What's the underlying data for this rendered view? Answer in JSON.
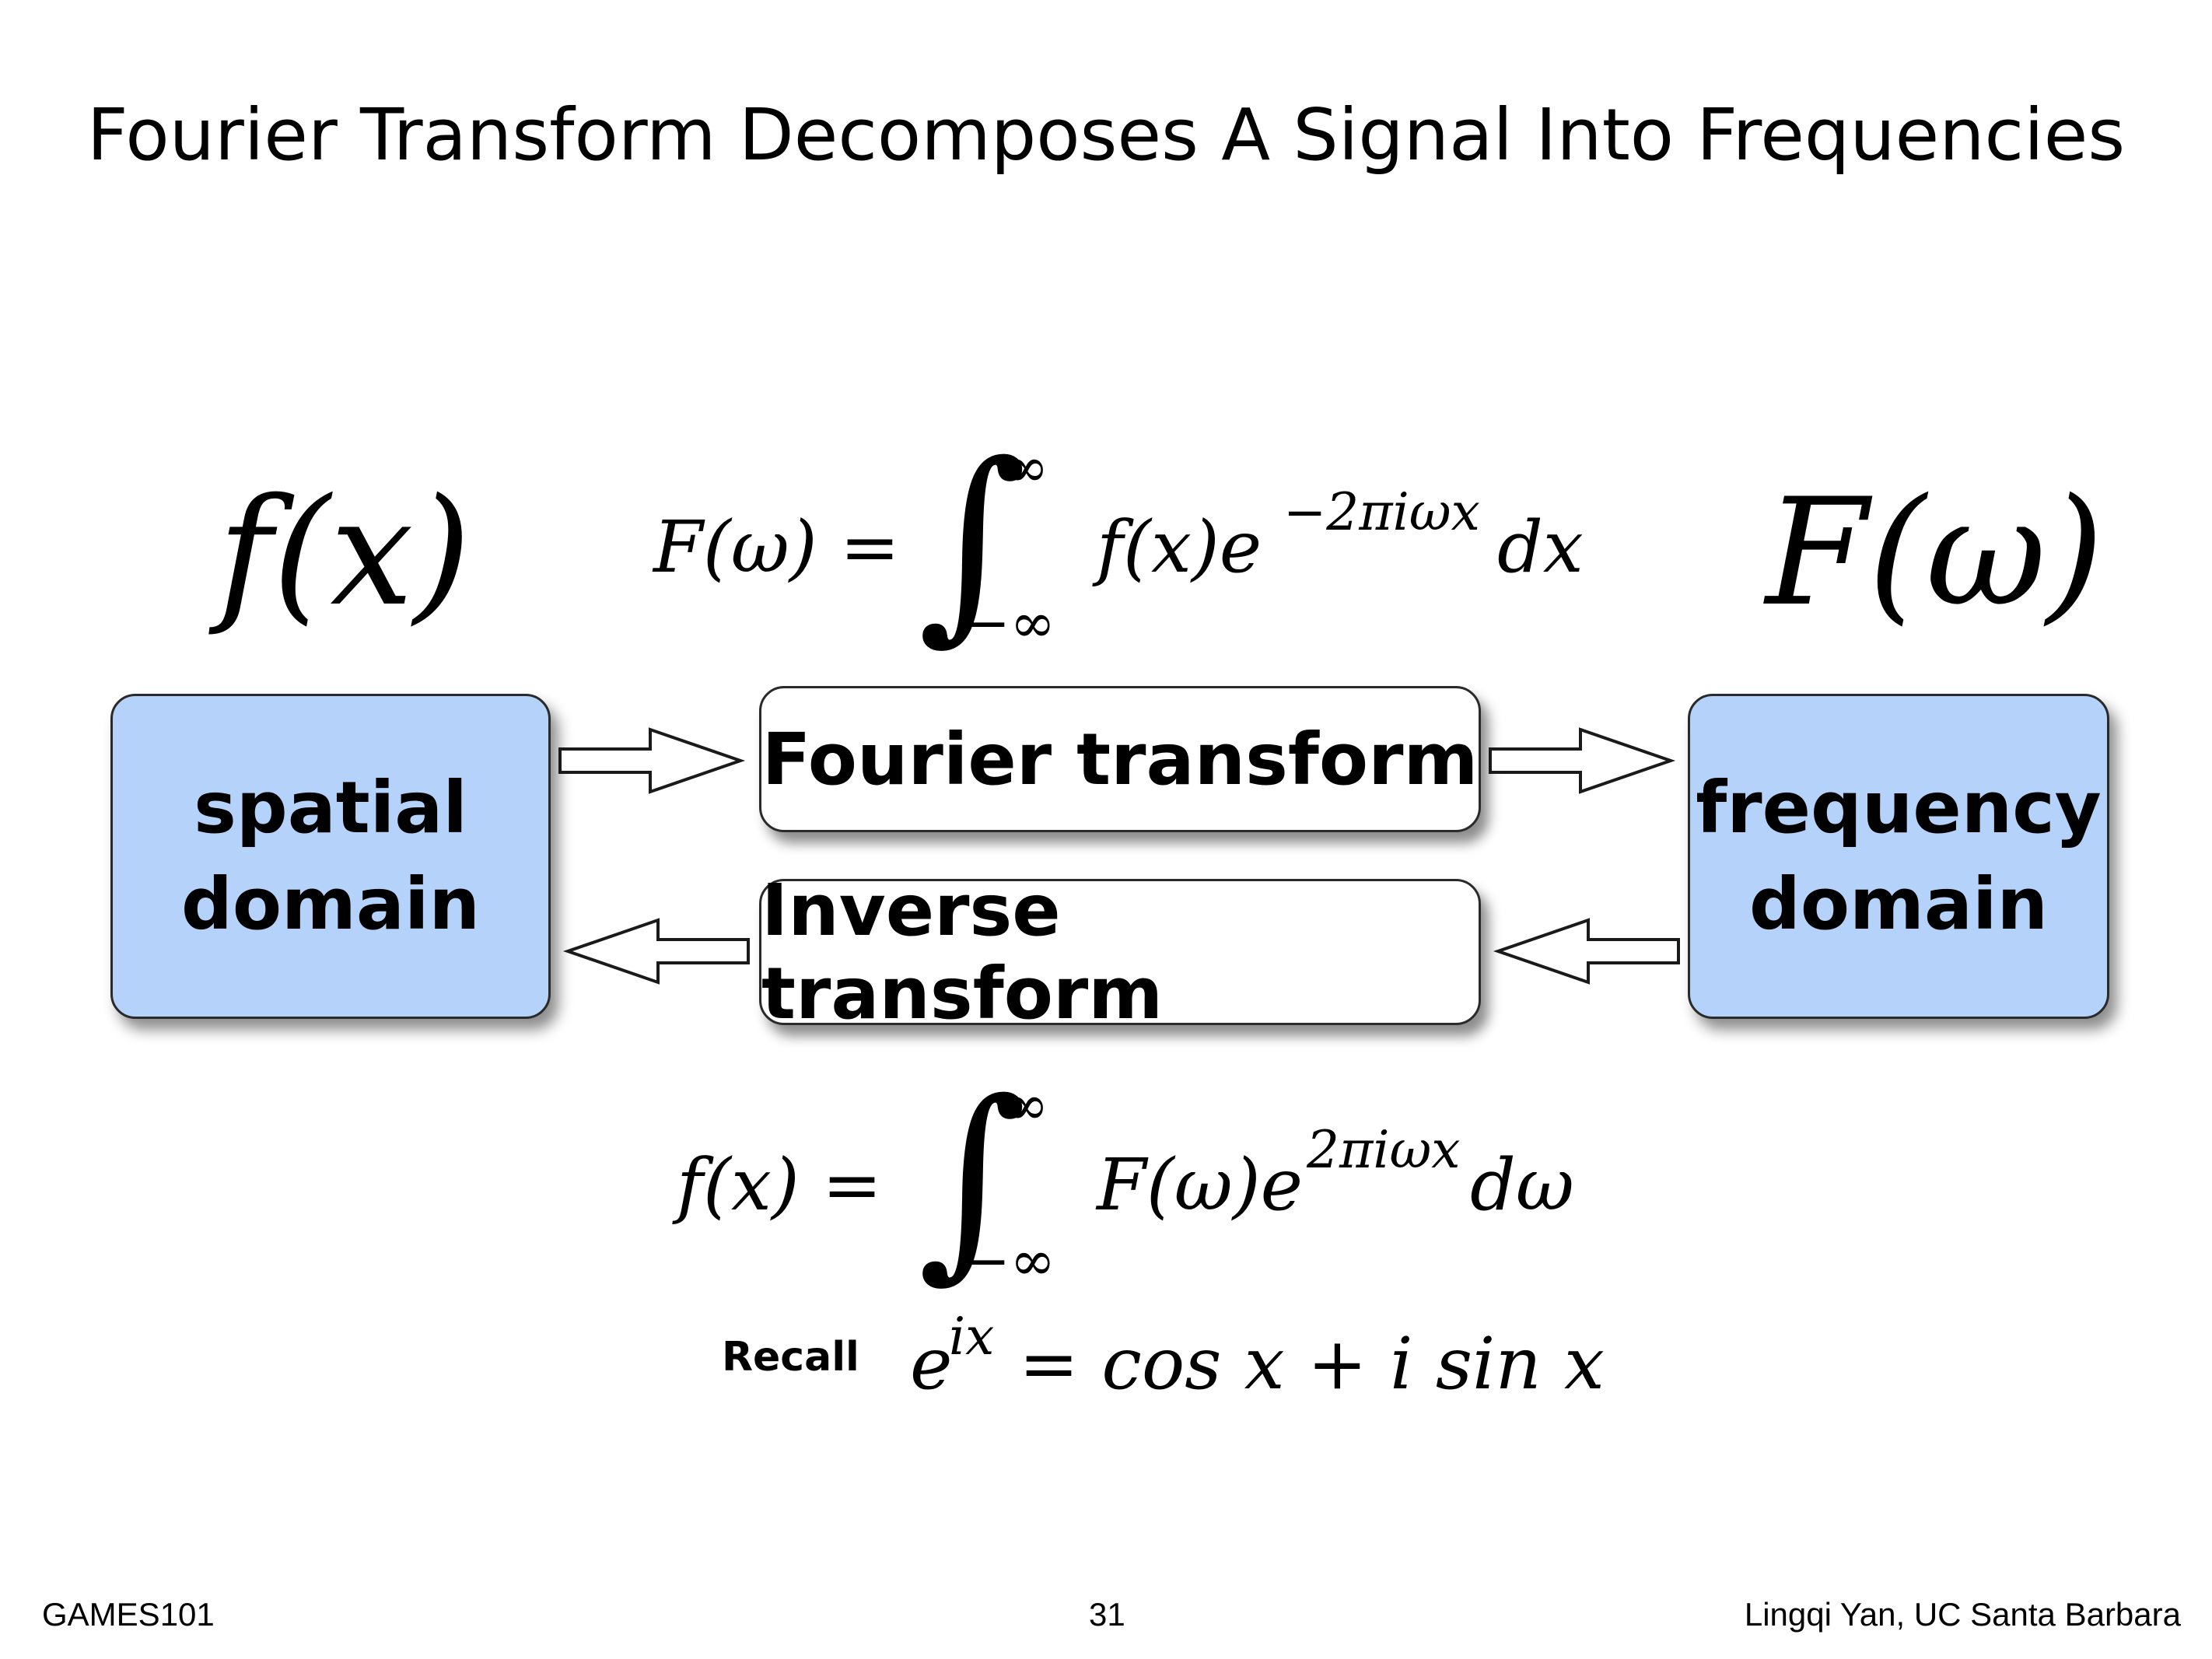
{
  "slide": {
    "title": "Fourier Transform Decomposes A Signal Into Frequencies",
    "footer_left": "GAMES101",
    "page_number": "31",
    "footer_right": "Lingqi Yan, UC Santa Barbara"
  },
  "labels": {
    "left_function": "f(x)",
    "right_function": "F(ω)"
  },
  "boxes": {
    "spatial_domain": [
      "spatial",
      "domain"
    ],
    "frequency_domain": [
      "frequency",
      "domain"
    ],
    "forward_transform": "Fourier transform",
    "inverse_transform": "Inverse transform"
  },
  "formulas": {
    "forward": {
      "lhs": "F(ω) =",
      "upper": "∞",
      "lower": "−∞",
      "integrand": "f(x)e",
      "exponent": "−2πiωx",
      "differential": "dx"
    },
    "inverse": {
      "lhs": "f(x) =",
      "upper": "∞",
      "lower": "−∞",
      "integrand": "F(ω)e",
      "exponent": "2πiωx",
      "differential": "dω"
    },
    "recall": {
      "label": "Recall",
      "base": "e",
      "exponent": "ix",
      "rhs": "= cos x + i sin x"
    }
  },
  "colors": {
    "domain_fill": "#b5d3fa",
    "box_border": "#2a2a2a"
  }
}
